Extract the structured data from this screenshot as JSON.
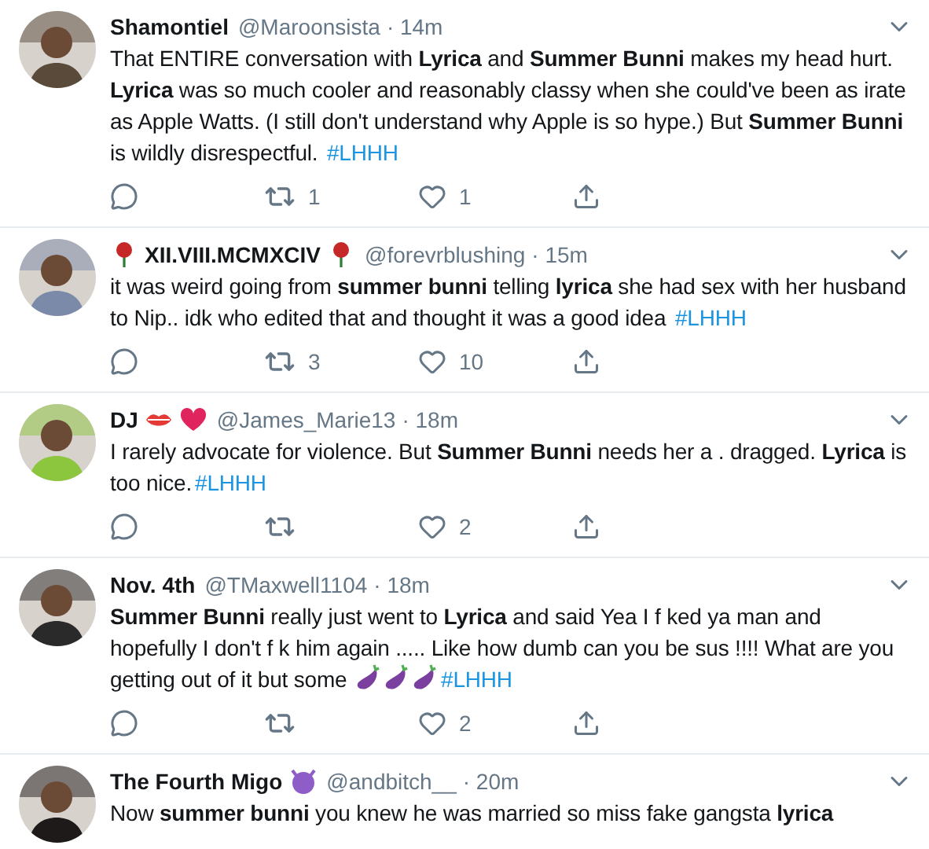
{
  "tweets": [
    {
      "name": "Shamontiel",
      "handle": "@Maroonsista",
      "time": "· 14m",
      "avatar": {
        "kind": "picture"
      },
      "body": [
        {
          "kind": "text",
          "text": "That ENTIRE conversation with **Lyrica** and **Summer Bunni** makes my head hurt. **Lyrica** was so much cooler and reasonably classy when she could've been as irate as Apple Watts. (I still don't understand why Apple is so hype.) But **Summer Bunni** is wildly disrespectful. "
        },
        {
          "kind": "hashtag",
          "text": "#LHHH"
        }
      ],
      "retweets": "1",
      "likes": "1"
    },
    {
      "name": "XII.VIII.MCMXCIV",
      "name_icons_before": [
        {
          "kind": "rose"
        }
      ],
      "name_icons_after": [
        {
          "kind": "rose"
        }
      ],
      "handle": "@forevrblushing",
      "time": "· 15m",
      "avatar": {
        "kind": "picture"
      },
      "body": [
        {
          "kind": "text",
          "text": "it was weird going from **summer bunni** telling **lyrica** she had sex with her husband to Nip.. idk who edited that and thought it was a good idea "
        },
        {
          "kind": "hashtag",
          "text": "#LHHH"
        }
      ],
      "retweets": "3",
      "likes": "10"
    },
    {
      "name": "DJ",
      "name_icons_after": [
        {
          "kind": "lips"
        },
        {
          "kind": "heart"
        }
      ],
      "handle": "@James_Marie13",
      "time": "· 18m",
      "avatar": {
        "kind": "picture"
      },
      "body": [
        {
          "kind": "text",
          "text": "I rarely advocate for violence. But **Summer Bunni** needs her a . dragged. **Lyrica** is too nice."
        },
        {
          "kind": "hashtag",
          "text": "#LHHH"
        }
      ],
      "likes": "2"
    },
    {
      "name": "Nov. 4th",
      "handle": "@TMaxwell1104",
      "time": "· 18m",
      "avatar": {
        "kind": "picture"
      },
      "body": [
        {
          "kind": "text",
          "text": "**Summer Bunni** really just went to **Lyrica** and said Yea I f ked ya man and hopefully I don't f k him again ..... Like how dumb can you be sus !!!! What are you getting out of it but some "
        },
        {
          "kind": "eggplant"
        },
        {
          "kind": "eggplant"
        },
        {
          "kind": "eggplant"
        },
        {
          "kind": "hashtag",
          "text": "#LHHH"
        }
      ],
      "likes": "2"
    },
    {
      "name": "The Fourth Migo",
      "name_icons_after": [
        {
          "kind": "devil"
        }
      ],
      "handle": "@andbitch__",
      "time": "· 20m",
      "avatar": {
        "kind": "picture"
      },
      "body": [
        {
          "kind": "text",
          "text": "Now **summer bunni** you knew he was married so miss fake gangsta **lyrica**"
        }
      ]
    }
  ]
}
